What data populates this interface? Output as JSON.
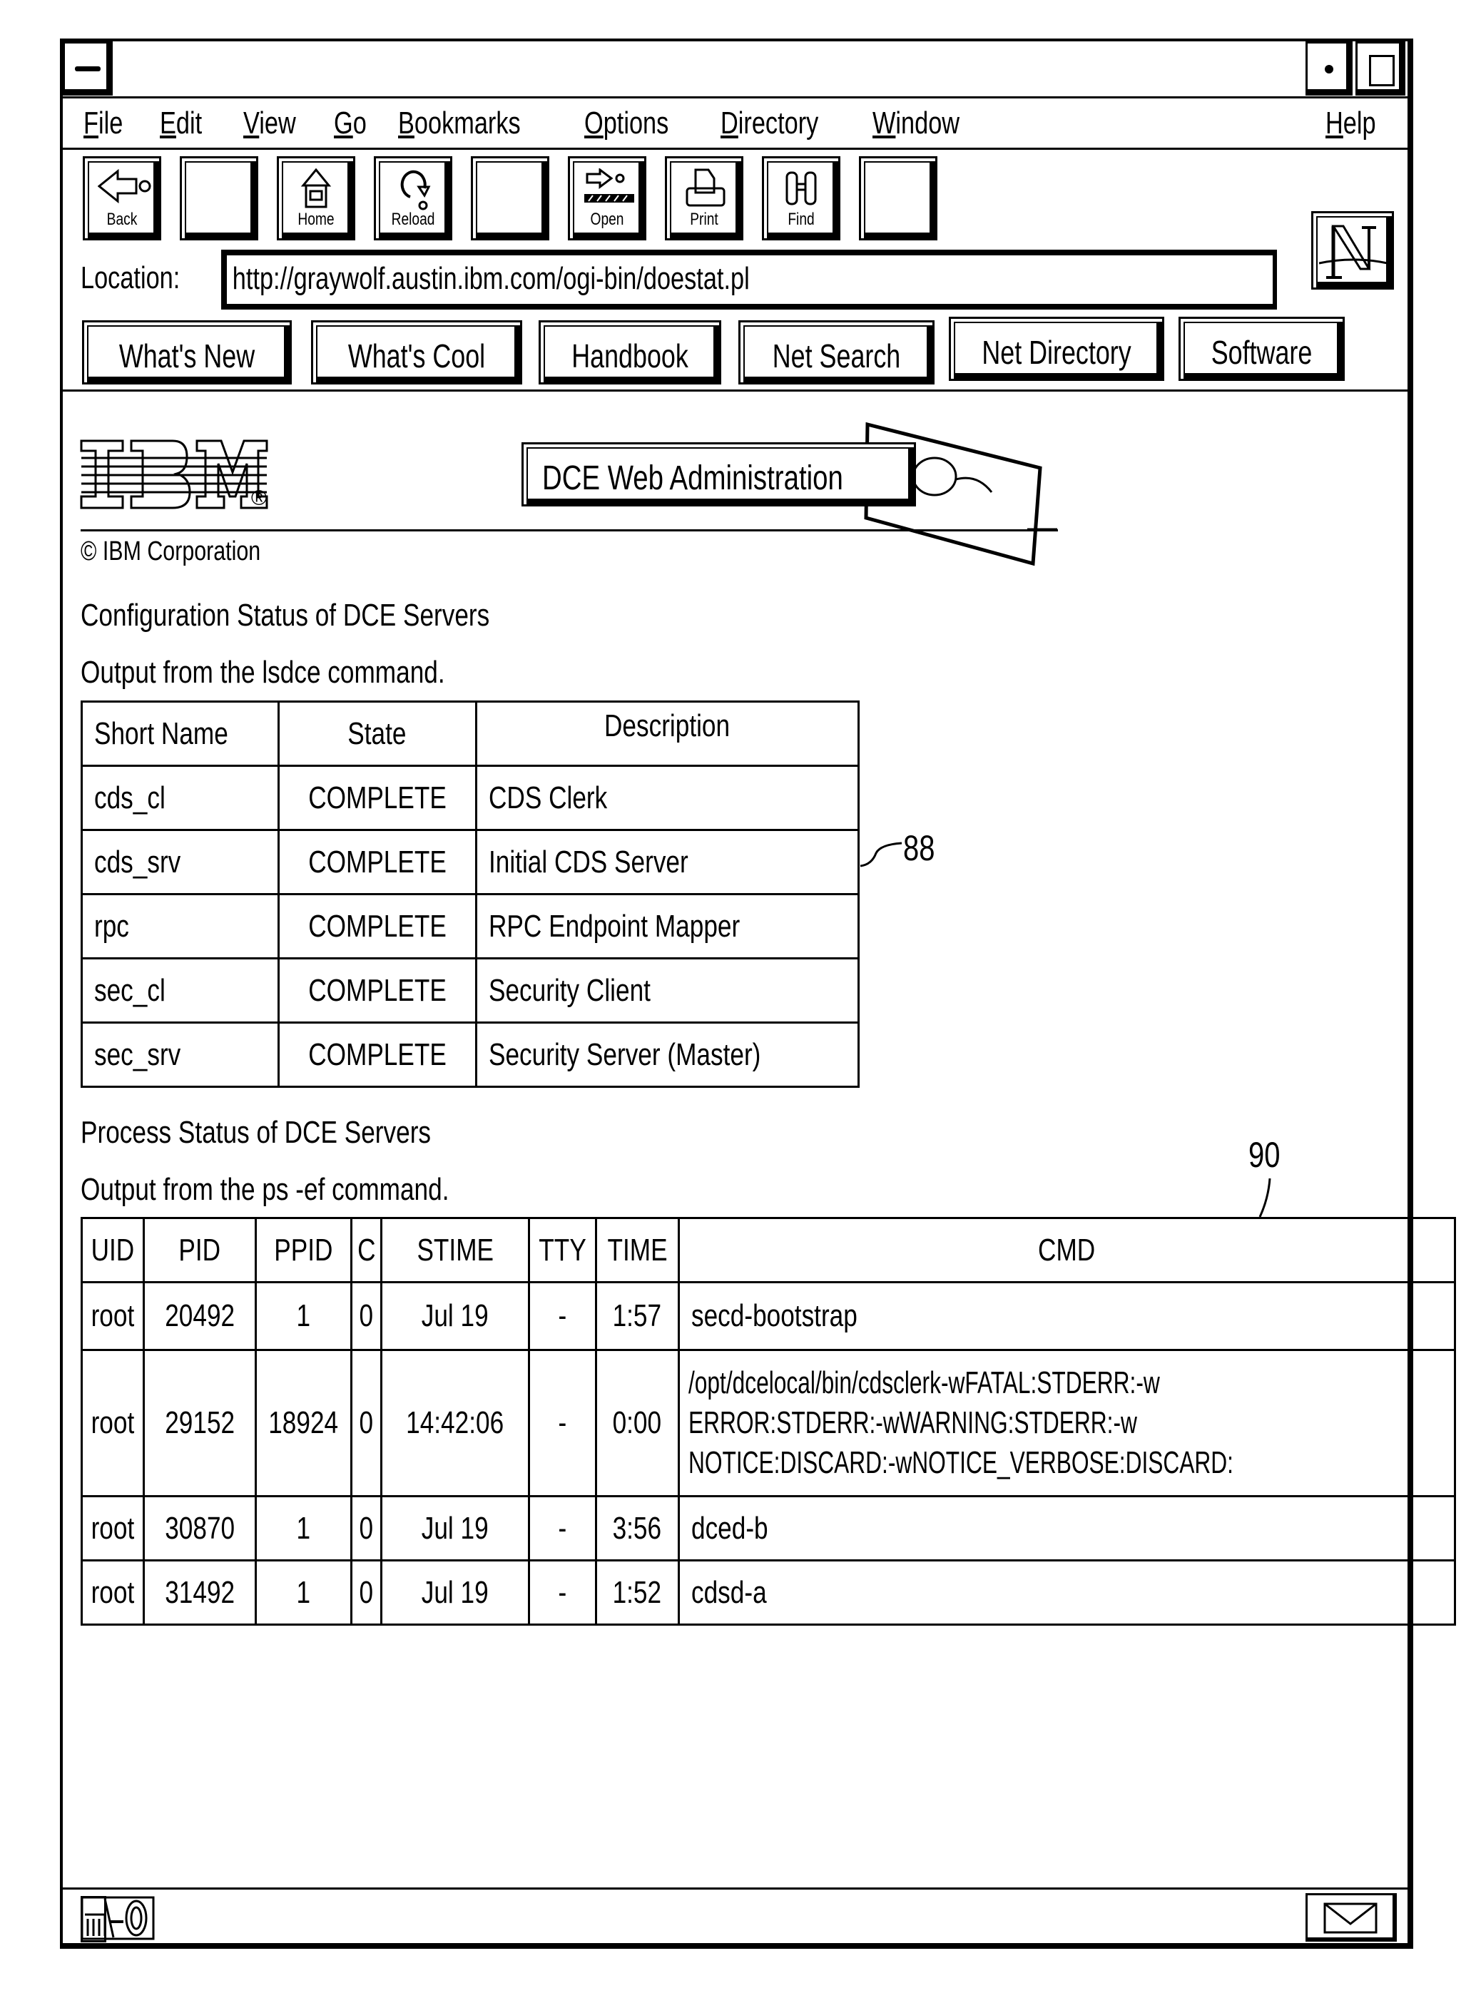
{
  "window": {
    "title": "",
    "controls": {
      "system_menu": "system-menu",
      "minimize": "minimize",
      "maximize": "maximize"
    }
  },
  "menubar": {
    "items": [
      {
        "label": "File",
        "mnemonic": "F",
        "rest": "ile"
      },
      {
        "label": "Edit",
        "mnemonic": "E",
        "rest": "dit"
      },
      {
        "label": "View",
        "mnemonic": "V",
        "rest": "iew"
      },
      {
        "label": "Go",
        "mnemonic": "G",
        "rest": "o"
      },
      {
        "label": "Bookmarks",
        "mnemonic": "B",
        "rest": "ookmarks"
      },
      {
        "label": "Options",
        "mnemonic": "O",
        "rest": "ptions"
      },
      {
        "label": "Directory",
        "mnemonic": "D",
        "rest": "irectory"
      },
      {
        "label": "Window",
        "mnemonic": "W",
        "rest": "indow"
      }
    ],
    "help": {
      "label": "Help",
      "mnemonic": "H",
      "rest": "elp"
    }
  },
  "toolbar": {
    "buttons": [
      {
        "label": "Back",
        "icon": "back-arrow-icon"
      },
      {
        "label": "",
        "icon": ""
      },
      {
        "label": "Home",
        "icon": "home-icon"
      },
      {
        "label": "Reload",
        "icon": "reload-icon"
      },
      {
        "label": "",
        "icon": ""
      },
      {
        "label": "Open",
        "icon": "open-icon"
      },
      {
        "label": "Print",
        "icon": "printer-icon"
      },
      {
        "label": "Find",
        "icon": "binoculars-icon"
      },
      {
        "label": "",
        "icon": ""
      }
    ],
    "logo": "N"
  },
  "location": {
    "label": "Location:",
    "value": "http://graywolf.austin.ibm.com/ogi-bin/doestat.pl"
  },
  "directory_buttons": [
    "What's New",
    "What's Cool",
    "Handbook",
    "Net Search",
    "Net Directory",
    "Software"
  ],
  "page": {
    "logo": "IBM",
    "registered": "®",
    "banner": "DCE Web Administration",
    "copyright": "© IBM Corporation",
    "config_heading": "Configuration Status of DCE Servers",
    "config_subheading": "Output from the lsdce command.",
    "config_table": {
      "headers": [
        "Short Name",
        "State",
        "Description"
      ],
      "rows": [
        [
          "cds_cl",
          "COMPLETE",
          "CDS Clerk"
        ],
        [
          "cds_srv",
          "COMPLETE",
          "Initial CDS Server"
        ],
        [
          "rpc",
          "COMPLETE",
          "RPC Endpoint Mapper"
        ],
        [
          "sec_cl",
          "COMPLETE",
          "Security Client"
        ],
        [
          "sec_srv",
          "COMPLETE",
          "Security Server (Master)"
        ]
      ],
      "ref_label": "88"
    },
    "process_heading": "Process Status of DCE Servers",
    "process_subheading": "Output from the ps -ef command.",
    "process_table": {
      "headers": [
        "UID",
        "PID",
        "PPID",
        "C",
        "STIME",
        "TTY",
        "TIME",
        "CMD"
      ],
      "rows": [
        [
          "root",
          "20492",
          "1",
          "0",
          "Jul 19",
          "-",
          "1:57",
          "secd-bootstrap"
        ],
        [
          "root",
          "29152",
          "18924",
          "0",
          "14:42:06",
          "-",
          "0:00",
          "/opt/dcelocal/bin/cdsclerk-wFATAL:STDERR:-w"
        ],
        [
          "root",
          "30870",
          "1",
          "0",
          "Jul 19",
          "-",
          "3:56",
          "dced-b"
        ],
        [
          "root",
          "31492",
          "1",
          "0",
          "Jul 19",
          "-",
          "1:52",
          "cdsd-a"
        ]
      ],
      "cmd_continuation": [
        "ERROR:STDERR:-wWARNING:STDERR:-w",
        "NOTICE:DISCARD:-wNOTICE_VERBOSE:DISCARD:"
      ],
      "ref_label": "90"
    }
  },
  "statusbar": {
    "security_icon": "key-icon",
    "mail_icon": "mail-icon"
  }
}
